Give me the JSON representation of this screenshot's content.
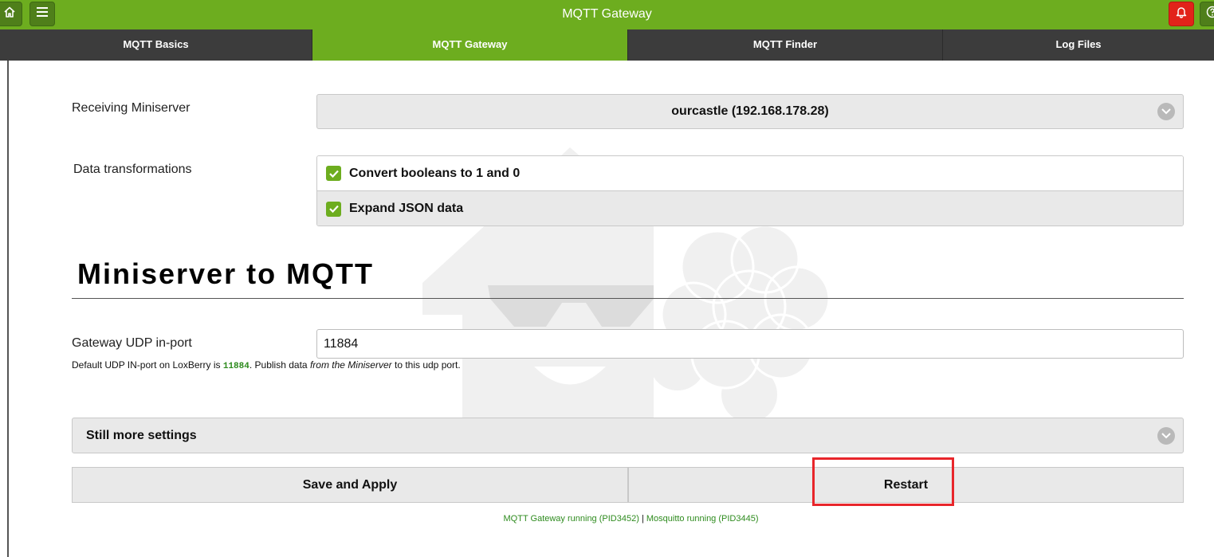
{
  "header": {
    "title": "MQTT Gateway",
    "icons": {
      "home": "home-icon",
      "menu": "hamburger-menu-icon",
      "notifications": "bell-icon",
      "help": "help-icon"
    },
    "colors": {
      "brand": "#6dad1f",
      "alert": "#e2231a"
    }
  },
  "tabs": [
    {
      "label": "MQTT Basics",
      "active": false
    },
    {
      "label": "MQTT Gateway",
      "active": true
    },
    {
      "label": "MQTT Finder",
      "active": false
    },
    {
      "label": "Log Files",
      "active": false
    }
  ],
  "form": {
    "miniserver_label": "Receiving Miniserver",
    "miniserver_value": "ourcastle (192.168.178.28)",
    "transform_label": "Data transformations",
    "transform_options": [
      {
        "label": "Convert booleans to 1 and 0",
        "checked": true
      },
      {
        "label": "Expand JSON data",
        "checked": true
      }
    ]
  },
  "section": {
    "title": "Miniserver to MQTT",
    "udp_label": "Gateway UDP in-port",
    "udp_value": "11884",
    "hint_prefix": "Default UDP IN-port on LoxBerry is",
    "hint_port": "11884",
    "hint_middle": ". Publish data",
    "hint_italic": "from the Miniserver",
    "hint_suffix": "to this udp port."
  },
  "more_settings": "Still more settings",
  "buttons": {
    "save": "Save and Apply",
    "restart": "Restart"
  },
  "status": {
    "gateway": "MQTT Gateway running (PID3452)",
    "separator": "|",
    "mosquitto": "Mosquitto running (PID3445)"
  }
}
